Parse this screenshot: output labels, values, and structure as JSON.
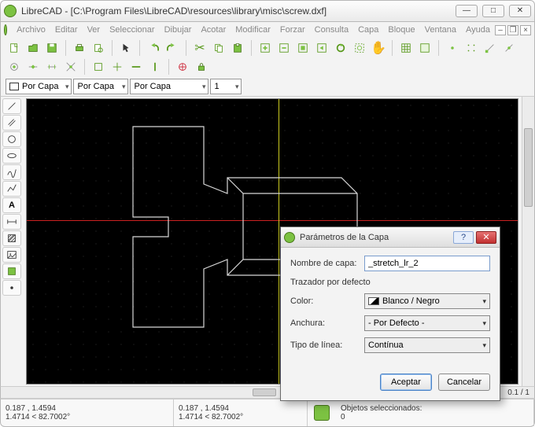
{
  "window": {
    "title": "LibreCAD - [C:\\Program Files\\LibreCAD\\resources\\library\\misc\\screw.dxf]"
  },
  "menu": {
    "items": [
      "Archivo",
      "Editar",
      "Ver",
      "Seleccionar",
      "Dibujar",
      "Acotar",
      "Modificar",
      "Forzar",
      "Consulta",
      "Capa",
      "Bloque",
      "Ventana",
      "Ayuda"
    ]
  },
  "layerbar": {
    "combo1": "Por Capa",
    "combo2": "Por Capa",
    "combo3": "Por Capa",
    "combo4": "1"
  },
  "viewport": {
    "axis_x_color": "#cc2222",
    "axis_y_color": "#cccc22",
    "zoom_ratio": "0.1 / 1"
  },
  "status": {
    "coord1a": "0.187 , 1.4594",
    "coord1b": "1.4714 < 82.7002°",
    "coord2a": "0.187 , 1.4594",
    "coord2b": "1.4714 < 82.7002°",
    "selection_label": "Objetos seleccionados:",
    "selection_count": "0"
  },
  "dialog": {
    "title": "Parámetros de la Capa",
    "name_label": "Nombre de capa:",
    "name_value": "_stretch_lr_2",
    "pen_group": "Trazador por defecto",
    "color_label": "Color:",
    "color_value": "Blanco / Negro",
    "width_label": "Anchura:",
    "width_value": "- Por Defecto -",
    "linetype_label": "Tipo de línea:",
    "linetype_value": "Contínua",
    "ok": "Aceptar",
    "cancel": "Cancelar"
  },
  "icons": {
    "new": "new-file-icon",
    "open": "open-icon",
    "save": "save-icon",
    "print": "print-icon",
    "preview": "print-preview-icon",
    "undo": "undo-icon",
    "redo": "redo-icon",
    "cut": "cut-icon",
    "copy": "copy-icon",
    "paste": "paste-icon",
    "cursor": "cursor-icon",
    "zoomin": "zoom-in-icon",
    "zoomout": "zoom-out-icon",
    "zoomauto": "zoom-auto-icon",
    "pan": "pan-icon",
    "zoomwin": "zoom-window-icon",
    "zoomprev": "zoom-previous-icon",
    "redraw": "redraw-icon",
    "grid": "grid-icon",
    "fullscreen": "fullscreen-icon",
    "snap1": "snap-free-icon",
    "snap2": "snap-grid-icon",
    "snap3": "snap-end-icon",
    "snap4": "snap-on-icon",
    "snap5": "snap-center-icon",
    "snap6": "snap-mid-icon",
    "snap7": "snap-dist-icon",
    "snap8": "snap-int-icon",
    "restrict1": "restrict-h-icon",
    "restrict2": "restrict-v-icon",
    "relzero": "rel-zero-icon",
    "lock": "lock-zero-icon"
  }
}
